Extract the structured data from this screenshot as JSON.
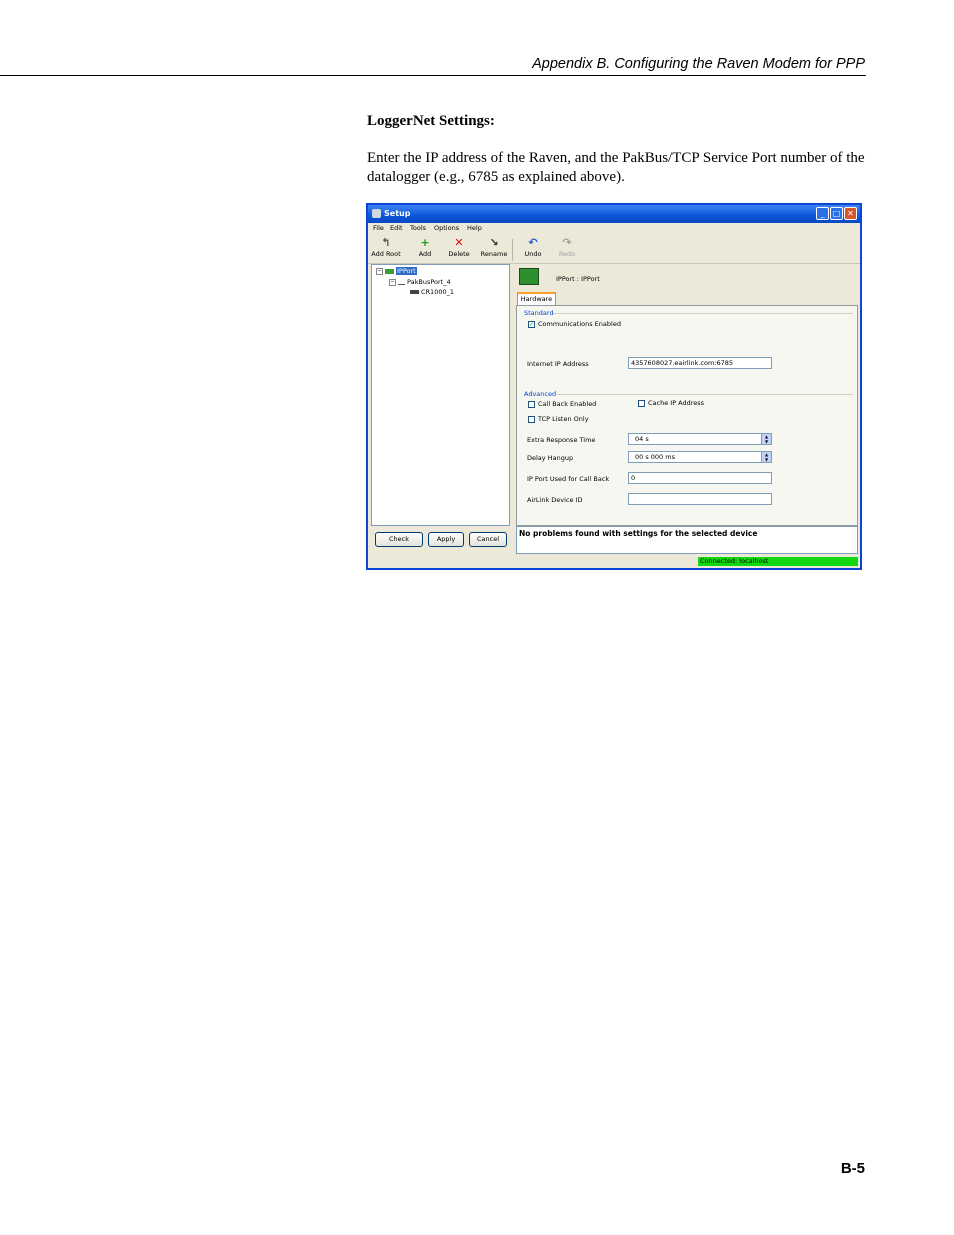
{
  "page": {
    "header": "Appendix B.  Configuring the Raven Modem for PPP",
    "section_title": "LoggerNet Settings:",
    "paragraph": "Enter the IP address of the Raven, and the PakBus/TCP Service Port number of the datalogger (e.g., 6785 as explained above).",
    "page_number": "B-5"
  },
  "window": {
    "title": "Setup",
    "controls": {
      "minimize": "_",
      "maximize": "□",
      "close": "✕"
    },
    "menu": [
      "File",
      "Edit",
      "Tools",
      "Options",
      "Help"
    ],
    "toolbar": {
      "add_root": "Add Root",
      "add": "Add",
      "delete": "Delete",
      "rename": "Rename",
      "undo": "Undo",
      "redo": "Redo"
    },
    "tree": {
      "root": "IPPort",
      "child": "PakBusPort_4",
      "leaf": "CR1000_1",
      "expand_symbol": "−"
    },
    "buttons": {
      "check": "Check",
      "apply": "Apply",
      "cancel": "Cancel"
    },
    "device_name": "IPPort : IPPort",
    "tab": "Hardware",
    "standard": {
      "group": "Standard",
      "comms_enabled_label": "Communications Enabled",
      "comms_enabled_checked": true,
      "check_mark": "✓",
      "ip_address_label": "Internet IP Address",
      "ip_address_value": "4357608027.eairlink.com:6785"
    },
    "advanced": {
      "group": "Advanced",
      "call_back_label": "Call Back Enabled",
      "cache_ip_label": "Cache IP Address",
      "tcp_listen_label": "TCP Listen Only",
      "extra_response_label": "Extra Response Time",
      "extra_response_value": "04 s",
      "delay_hangup_label": "Delay Hangup",
      "delay_hangup_value": "00 s 000 ms",
      "ip_port_callback_label": "IP Port Used for Call Back",
      "ip_port_callback_value": "0",
      "airlink_id_label": "AirLink Device ID",
      "airlink_id_value": "",
      "spin_up": "▲",
      "spin_down": "▼"
    },
    "message": "No problems found with settings for the selected device",
    "status": "Connected: localhost",
    "colors": {
      "title_bar": "#0a55d8",
      "status_connected": "#11d811",
      "group_label": "#0046d5"
    }
  }
}
